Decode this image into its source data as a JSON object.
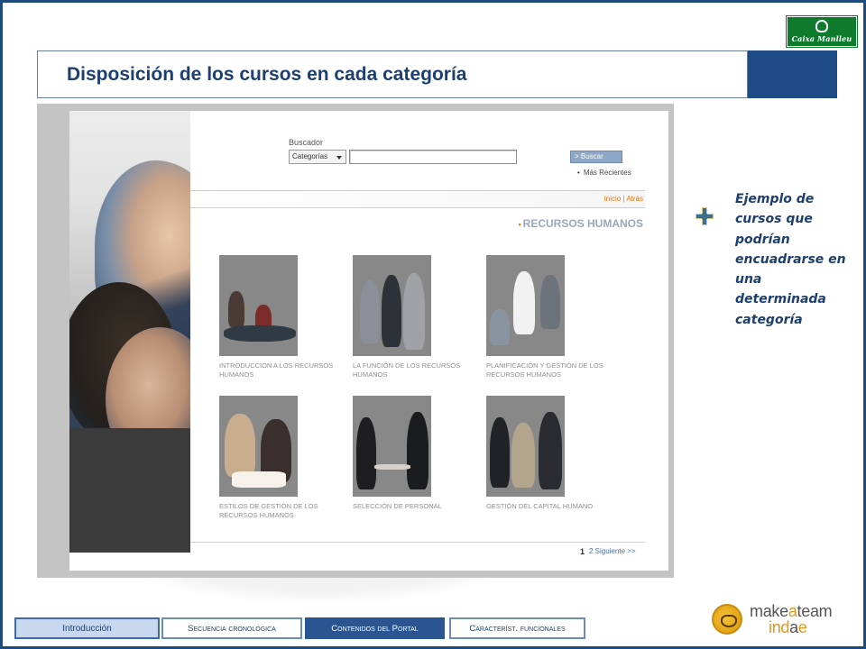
{
  "header": {
    "title": "Disposición de los cursos en cada categoría",
    "logo_text": "Caixa Manlleu"
  },
  "portal": {
    "search_label": "Buscador",
    "search_select_value": "Categorías",
    "search_button_label": "> Buscar",
    "recent_link": "Más Recientes",
    "nav_links": "Inicio | Atrás",
    "section_heading": "RECURSOS HUMANOS",
    "courses": [
      {
        "caption": "INTRODUCCION A LOS RECURSOS HUMANOS"
      },
      {
        "caption": "LA FUNCIÓN DE LOS RECURSOS HUMANOS"
      },
      {
        "caption": "PLANIFICACIÓN Y GESTIÓN DE LOS RECURSOS HUMANOS"
      },
      {
        "caption": "ESTILOS DE GESTIÓN DE LOS RECURSOS HUMANOS"
      },
      {
        "caption": "SELECCIÓN DE PERSONAL"
      },
      {
        "caption": "GESTIÓN DEL CAPITAL HUMANO"
      }
    ],
    "pagination_current": "1",
    "pagination_next": "2 Siguiente >>"
  },
  "side_note": "Ejemplo de cursos que podrían encuadrarse en una determinada categoría",
  "tabs": [
    {
      "label": "Introducción"
    },
    {
      "label": "Secuencia cronológica"
    },
    {
      "label": "Contenidos del Portal"
    },
    {
      "label": "Característ. funcionales"
    }
  ],
  "footer_logo": {
    "word1_prefix": "make",
    "word1_accent": "a",
    "word1_suffix": "team",
    "word2_prefix": "ind",
    "word2_accent": "a",
    "word2_suffix": "e"
  },
  "colors": {
    "accent_blue": "#1e4a85",
    "title_text": "#1d3f70",
    "link_orange": "#e07a12",
    "caixa_green": "#0e7a2c",
    "active_tab": "#2a5590"
  }
}
